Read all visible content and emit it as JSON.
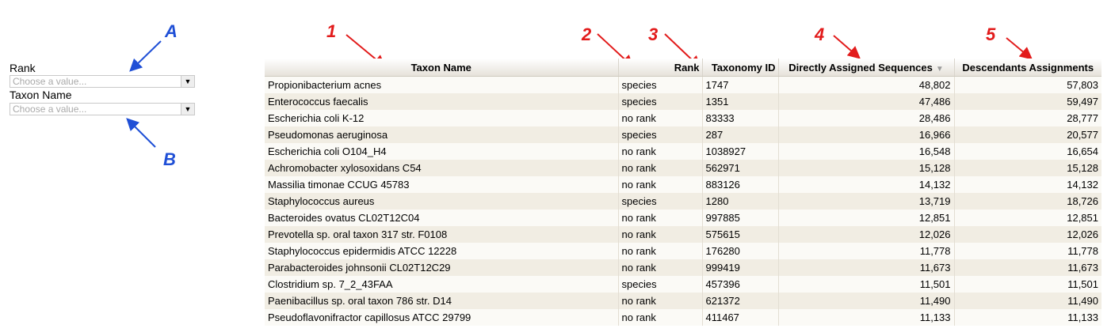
{
  "filters": {
    "rank": {
      "label": "Rank",
      "placeholder": "Choose a value..."
    },
    "taxon_name": {
      "label": "Taxon Name",
      "placeholder": "Choose a value..."
    }
  },
  "annotations": [
    "1",
    "2",
    "3",
    "4",
    "5",
    "A",
    "B"
  ],
  "table": {
    "columns": [
      "Taxon Name",
      "Rank",
      "Taxonomy ID",
      "Directly Assigned Sequences",
      "Descendants Assignments"
    ],
    "sort_indicator": "▼",
    "rows": [
      [
        "Propionibacterium acnes",
        "species",
        "1747",
        "48,802",
        "57,803"
      ],
      [
        "Enterococcus faecalis",
        "species",
        "1351",
        "47,486",
        "59,497"
      ],
      [
        "Escherichia coli K-12",
        "no rank",
        "83333",
        "28,486",
        "28,777"
      ],
      [
        "Pseudomonas aeruginosa",
        "species",
        "287",
        "16,966",
        "20,577"
      ],
      [
        "Escherichia coli O104_H4",
        "no rank",
        "1038927",
        "16,548",
        "16,654"
      ],
      [
        "Achromobacter xylosoxidans C54",
        "no rank",
        "562971",
        "15,128",
        "15,128"
      ],
      [
        "Massilia timonae CCUG 45783",
        "no rank",
        "883126",
        "14,132",
        "14,132"
      ],
      [
        "Staphylococcus aureus",
        "species",
        "1280",
        "13,719",
        "18,726"
      ],
      [
        "Bacteroides ovatus CL02T12C04",
        "no rank",
        "997885",
        "12,851",
        "12,851"
      ],
      [
        "Prevotella sp. oral taxon 317 str. F0108",
        "no rank",
        "575615",
        "12,026",
        "12,026"
      ],
      [
        "Staphylococcus epidermidis ATCC 12228",
        "no rank",
        "176280",
        "11,778",
        "11,778"
      ],
      [
        "Parabacteroides johnsonii CL02T12C29",
        "no rank",
        "999419",
        "11,673",
        "11,673"
      ],
      [
        "Clostridium sp. 7_2_43FAA",
        "species",
        "457396",
        "11,501",
        "11,501"
      ],
      [
        "Paenibacillus sp. oral taxon 786 str. D14",
        "no rank",
        "621372",
        "11,490",
        "11,490"
      ],
      [
        "Pseudoflavonifractor capillosus ATCC 29799",
        "no rank",
        "411467",
        "11,133",
        "11,133"
      ]
    ]
  }
}
